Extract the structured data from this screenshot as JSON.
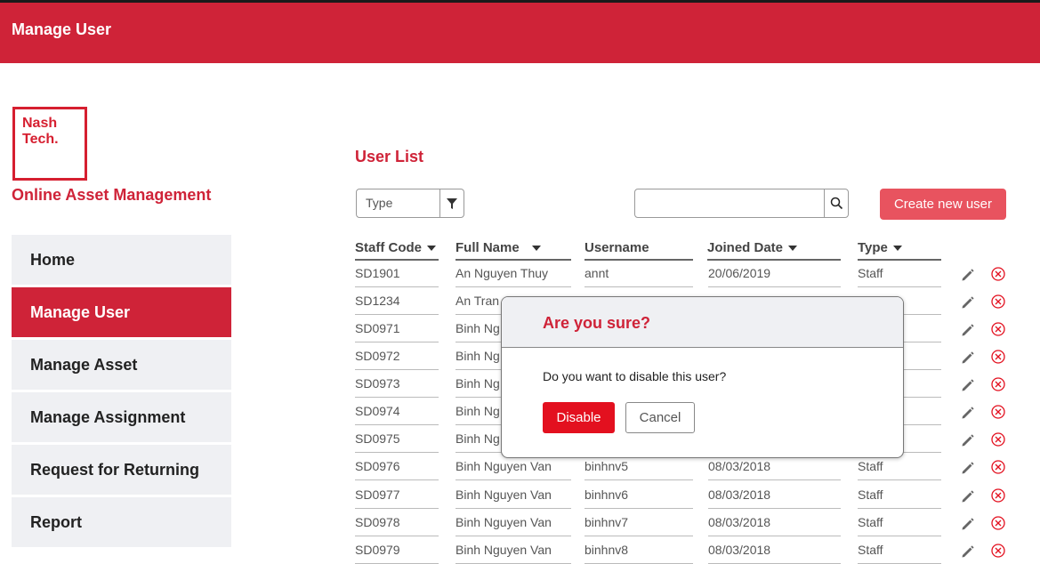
{
  "header": {
    "title": "Manage User"
  },
  "brand": {
    "logo_line1": "Nash",
    "logo_line2": "Tech.",
    "app_name": "Online Asset Management",
    "accent_color": "#cf2338"
  },
  "sidebar": {
    "items": [
      {
        "label": "Home",
        "active": false
      },
      {
        "label": "Manage User",
        "active": true
      },
      {
        "label": "Manage Asset",
        "active": false
      },
      {
        "label": "Manage Assignment",
        "active": false
      },
      {
        "label": "Request for Returning",
        "active": false
      },
      {
        "label": "Report",
        "active": false
      }
    ]
  },
  "main": {
    "section_title": "User List",
    "filter": {
      "placeholder": "Type",
      "icon": "filter-icon"
    },
    "search": {
      "value": "",
      "icon": "search-icon"
    },
    "create_button": "Create new user",
    "columns": [
      "Staff Code",
      "Full Name",
      "Username",
      "Joined Date",
      "Type"
    ],
    "rows": [
      {
        "staff_code": "SD1901",
        "full_name": "An Nguyen Thuy",
        "username": "annt",
        "joined_date": "20/06/2019",
        "type": "Staff"
      },
      {
        "staff_code": "SD1234",
        "full_name": "An Tran",
        "username": "",
        "joined_date": "",
        "type": ""
      },
      {
        "staff_code": "SD0971",
        "full_name": "Binh Ng",
        "username": "",
        "joined_date": "",
        "type": ""
      },
      {
        "staff_code": "SD0972",
        "full_name": "Binh Ng",
        "username": "",
        "joined_date": "",
        "type": ""
      },
      {
        "staff_code": "SD0973",
        "full_name": "Binh Ng",
        "username": "",
        "joined_date": "",
        "type": ""
      },
      {
        "staff_code": "SD0974",
        "full_name": "Binh Ng",
        "username": "",
        "joined_date": "",
        "type": ""
      },
      {
        "staff_code": "SD0975",
        "full_name": "Binh Ng",
        "username": "",
        "joined_date": "",
        "type": ""
      },
      {
        "staff_code": "SD0976",
        "full_name": "Binh Nguyen Van",
        "username": "binhnv5",
        "joined_date": "08/03/2018",
        "type": "Staff"
      },
      {
        "staff_code": "SD0977",
        "full_name": "Binh Nguyen Van",
        "username": "binhnv6",
        "joined_date": "08/03/2018",
        "type": "Staff"
      },
      {
        "staff_code": "SD0978",
        "full_name": "Binh Nguyen Van",
        "username": "binhnv7",
        "joined_date": "08/03/2018",
        "type": "Staff"
      },
      {
        "staff_code": "SD0979",
        "full_name": "Binh Nguyen Van",
        "username": "binhnv8",
        "joined_date": "08/03/2018",
        "type": "Staff"
      }
    ],
    "row_actions": {
      "edit_icon": "pencil-icon",
      "disable_icon": "circle-x-icon",
      "disable_color": "#e3101f"
    }
  },
  "modal": {
    "title": "Are you sure?",
    "message": "Do you want to disable this user?",
    "confirm_label": "Disable",
    "cancel_label": "Cancel"
  }
}
